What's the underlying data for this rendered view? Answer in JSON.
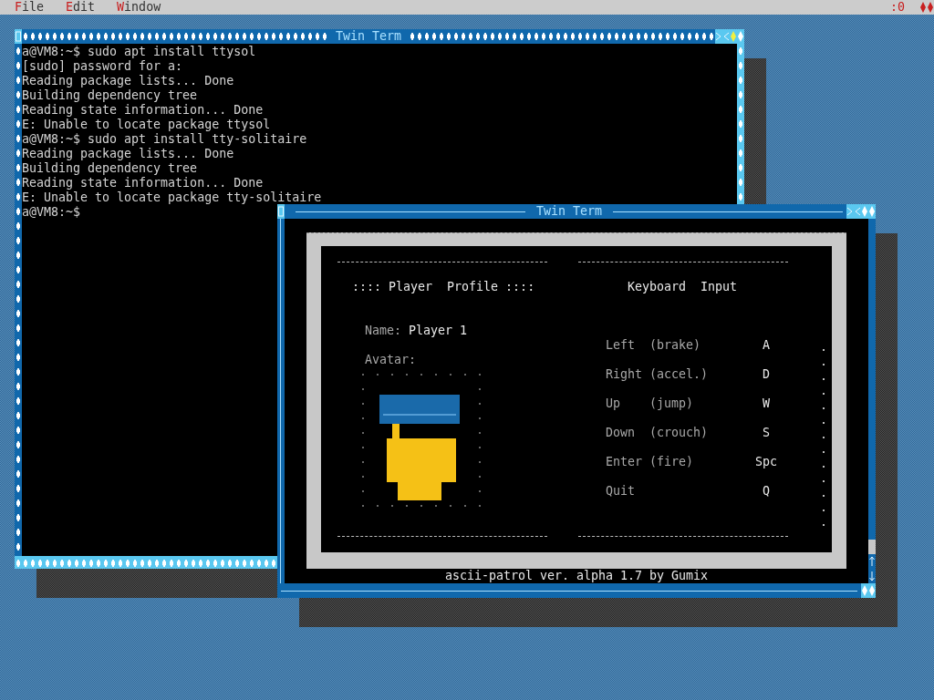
{
  "menu_bar": {
    "items": [
      {
        "label": "File"
      },
      {
        "label": "Edit"
      },
      {
        "label": "Window"
      }
    ],
    "display": ":0"
  },
  "terminal_window": {
    "title": "Twin Term",
    "lines": [
      "a@VM8:~$ sudo apt install ttysol",
      "[sudo] password for a:",
      "Reading package lists... Done",
      "Building dependency tree",
      "Reading state information... Done",
      "E: Unable to locate package ttysol",
      "a@VM8:~$ sudo apt install tty-solitaire",
      "Reading package lists... Done",
      "Building dependency tree",
      "Reading state information... Done",
      "E: Unable to locate package tty-solitaire",
      "a@VM8:~$"
    ]
  },
  "game_window": {
    "title": "Twin Term",
    "profile": {
      "heading": ":::: Player  Profile ::::",
      "name_label": "Name:",
      "name_value": "Player 1",
      "avatar_label": "Avatar:"
    },
    "keyboard": {
      "heading": "Keyboard  Input",
      "bindings": [
        {
          "action": "Left",
          "hint": "(brake)",
          "key": "A"
        },
        {
          "action": "Right",
          "hint": "(accel.)",
          "key": "D"
        },
        {
          "action": "Up",
          "hint": "(jump)",
          "key": "W"
        },
        {
          "action": "Down",
          "hint": "(crouch)",
          "key": "S"
        },
        {
          "action": "Enter",
          "hint": "(fire)",
          "key": "Spc"
        },
        {
          "action": "Quit",
          "key": "Q"
        }
      ]
    },
    "status": "ascii-patrol ver. alpha 1.7 by Gumix"
  }
}
